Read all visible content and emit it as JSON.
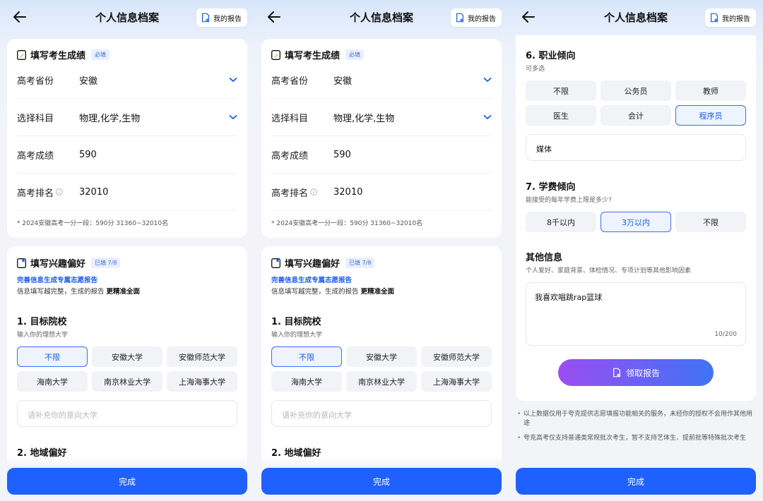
{
  "header": {
    "title": "个人信息档案",
    "report_label": "我的报告"
  },
  "score_section": {
    "title": "填写考生成绩",
    "badge": "必填",
    "rows": [
      {
        "label": "高考省份",
        "value": "安徽"
      },
      {
        "label": "选择科目",
        "value": "物理,化学,生物"
      },
      {
        "label": "高考成绩",
        "value": "590"
      },
      {
        "label": "高考排名",
        "value": "32010"
      }
    ],
    "note": "* 2024安徽高考一分一段：590分 31360~32010名"
  },
  "interest_section": {
    "title": "填写兴趣偏好",
    "badge": "已填 7/8",
    "link": "完善信息生成专属志愿报告",
    "sub_prefix": "信息填写越完整，生成的报告",
    "sub_bold": "更精准全面",
    "q1": {
      "title": "1. 目标院校",
      "hint": "输入你的理想大学",
      "options": [
        "不限",
        "安徽大学",
        "安徽师范大学",
        "海南大学",
        "南京林业大学",
        "上海海事大学"
      ],
      "selected": "不限",
      "placeholder": "请补充你的意向大学"
    },
    "q2": {
      "title": "2. 地域偏好"
    }
  },
  "career_section": {
    "q6": {
      "title": "6. 职业倾向",
      "hint": "可多选",
      "options": [
        "不限",
        "公务员",
        "教师",
        "医生",
        "会计",
        "程序员"
      ],
      "selected": "程序员",
      "extra_value": "媒体"
    },
    "q7": {
      "title": "7. 学费倾向",
      "hint": "能接受的每年学费上限是多少?",
      "options": [
        "8千以内",
        "3万以内",
        "不限"
      ],
      "selected": "3万以内"
    },
    "other": {
      "title": "其他信息",
      "hint": "个人爱好、家庭背景、体检情况、专项计划等其他影响因素",
      "value": "我喜欢唱跳rap篮球",
      "counter": "10/200"
    },
    "get_report_label": "领取报告"
  },
  "disclaimers": [
    "以上数据仅用于夸克提供志愿填报功能相关的服务，未经你的授权不会用作其他用途",
    "夸克高考仅支持普通类常规批次考生，暂不支持艺体生、提前批等特殊批次考生"
  ],
  "done_label": "完成",
  "colors": {
    "accent": "#1e61ff",
    "selected_border": "#3a6ff2",
    "gradient_start": "#9b4ef2",
    "gradient_end": "#3f73f5"
  },
  "icons": [
    "back-arrow-icon",
    "report-doc-icon",
    "pencil-doc-icon",
    "chevron-down-icon",
    "info-icon"
  ]
}
